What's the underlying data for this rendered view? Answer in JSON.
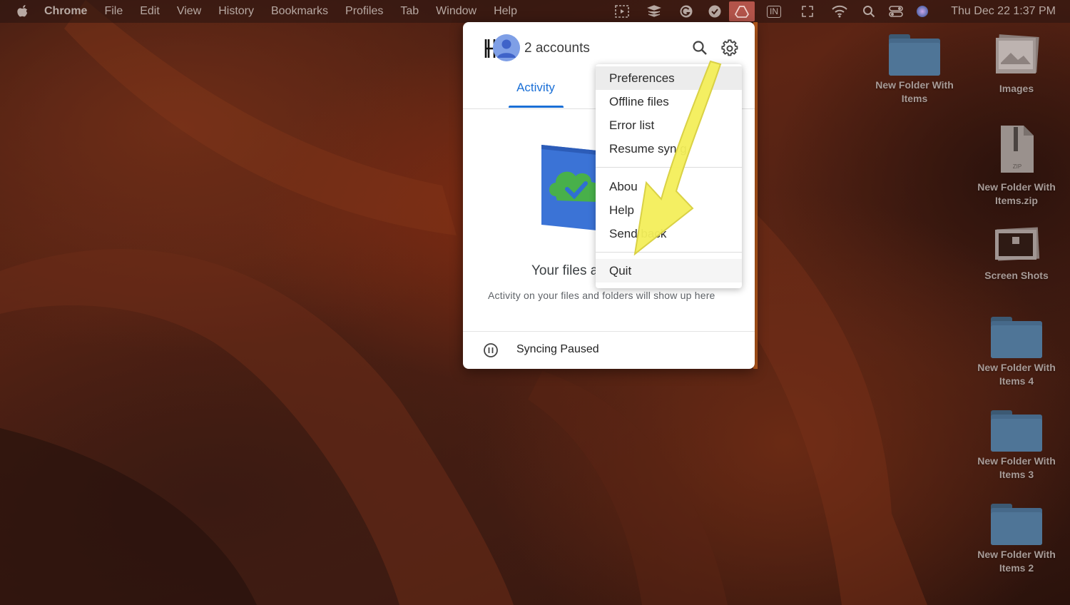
{
  "menubar": {
    "app_name": "Chrome",
    "items": [
      "File",
      "Edit",
      "View",
      "History",
      "Bookmarks",
      "Profiles",
      "Tab",
      "Window",
      "Help"
    ],
    "status_icons": [
      "screen-capture-icon",
      "stack-icon",
      "grammarly-icon",
      "checkmark-icon",
      "google-drive-icon",
      "input-source-icon",
      "expand-icon",
      "wifi-icon",
      "spotlight-search-icon",
      "control-center-icon",
      "siri-icon"
    ],
    "input_source": "IN",
    "datetime": "Thu Dec 22  1:37 PM"
  },
  "drive_popup": {
    "accounts_label": "2 accounts",
    "tab_activity": "Activity",
    "main_message": "Your files a",
    "sub_message": "Activity on your files and folders will show up here",
    "sync_status": "Syncing Paused",
    "accent_color": "#1a6fd6"
  },
  "settings_menu": {
    "group1": [
      "Preferences",
      "Offline files",
      "Error list",
      "Resume syn    g"
    ],
    "group2": [
      "Abou",
      "Help",
      "Send      back"
    ],
    "group3": [
      "Quit"
    ]
  },
  "desktop_icons": [
    {
      "label_line1": "New Folder With",
      "label_line2": "Items"
    },
    {
      "label_line1": "Images",
      "label_line2": ""
    },
    {
      "label_line1": "New Folder With",
      "label_line2": "Items.zip"
    },
    {
      "label_line1": "Screen Shots",
      "label_line2": ""
    },
    {
      "label_line1": "New Folder With",
      "label_line2": "Items 4"
    },
    {
      "label_line1": "New Folder With",
      "label_line2": "Items 3"
    },
    {
      "label_line1": "New Folder With",
      "label_line2": "Items 2"
    }
  ],
  "zip_badge": "ZIP",
  "arrow_color": "#f4ef5a"
}
